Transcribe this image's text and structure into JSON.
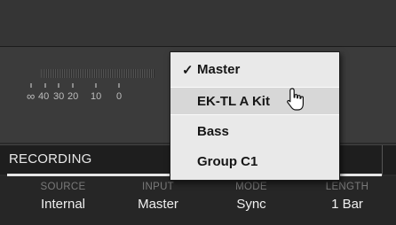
{
  "meter": {
    "scale_labels": [
      "∞",
      "40",
      "30",
      "20",
      "10",
      "0"
    ]
  },
  "recording": {
    "title": "RECORDING",
    "params": [
      {
        "label": "SOURCE",
        "value": "Internal"
      },
      {
        "label": "INPUT",
        "value": "Master"
      },
      {
        "label": "MODE",
        "value": "Sync"
      },
      {
        "label": "LENGTH",
        "value": "1 Bar"
      }
    ]
  },
  "dropdown": {
    "items": [
      {
        "label": "Master",
        "checked": true
      },
      {
        "label": "EK-TL A Kit",
        "highlighted": true
      },
      {
        "label": "Bass"
      },
      {
        "label": "Group C1"
      }
    ],
    "check_glyph": "✓"
  }
}
